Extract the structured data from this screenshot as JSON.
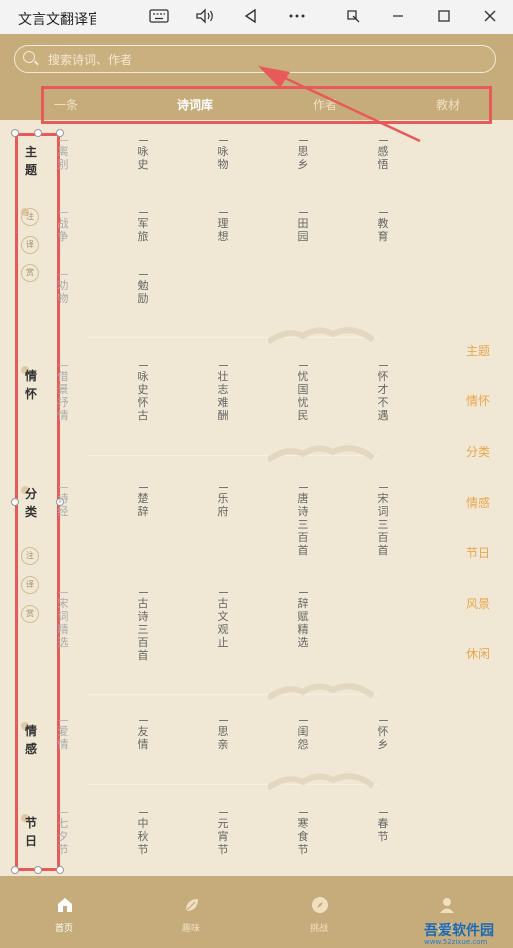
{
  "window": {
    "title": "文言文翻译官"
  },
  "search": {
    "placeholder": "搜索诗词、作者"
  },
  "tabs": [
    "一条",
    "诗词库",
    "作者",
    "教材"
  ],
  "sections": [
    {
      "label": "主题",
      "notes": [
        "注",
        "译",
        "赏"
      ]
    },
    {
      "label": "情怀"
    },
    {
      "label": "分类",
      "notes": [
        "注",
        "译",
        "赏"
      ]
    },
    {
      "label": "情感"
    },
    {
      "label": "节日"
    }
  ],
  "grid": [
    [
      "离别",
      "咏史",
      "咏物",
      "思乡",
      "感悟"
    ],
    [
      "战争",
      "军旅",
      "理想",
      "田园",
      "教育"
    ],
    [
      "劝物",
      "勉励"
    ],
    [
      "借景抒情",
      "咏史怀古",
      "壮志难酬",
      "忧国忧民",
      "怀才不遇"
    ],
    [
      "诗经",
      "楚辞",
      "乐府",
      "唐诗三百首",
      "宋词三百首"
    ],
    [
      "宋词精选",
      "古诗三百首",
      "古文观止",
      "辞赋精选"
    ],
    [
      "爱情",
      "友情",
      "思亲",
      "闺怨",
      "怀乡"
    ],
    [
      "七夕节",
      "中秋节",
      "元宵节",
      "寒食节",
      "春节"
    ]
  ],
  "right_index": [
    "主题",
    "情怀",
    "分类",
    "情感",
    "节日",
    "风景",
    "休闲"
  ],
  "bottom_nav": [
    {
      "label": "首页",
      "icon": "home-icon"
    },
    {
      "label": "趣味",
      "icon": "leaf-icon"
    },
    {
      "label": "挑战",
      "icon": "compass-icon"
    },
    {
      "label": "我的",
      "icon": "user-icon"
    }
  ],
  "watermark": {
    "brand": "吾爱软件园",
    "url": "www.52zixue.com"
  },
  "colors": {
    "header": "#c6ac7a",
    "background": "#f0e8d4",
    "accent": "#e8a64e",
    "annotation": "#e85a5a"
  }
}
